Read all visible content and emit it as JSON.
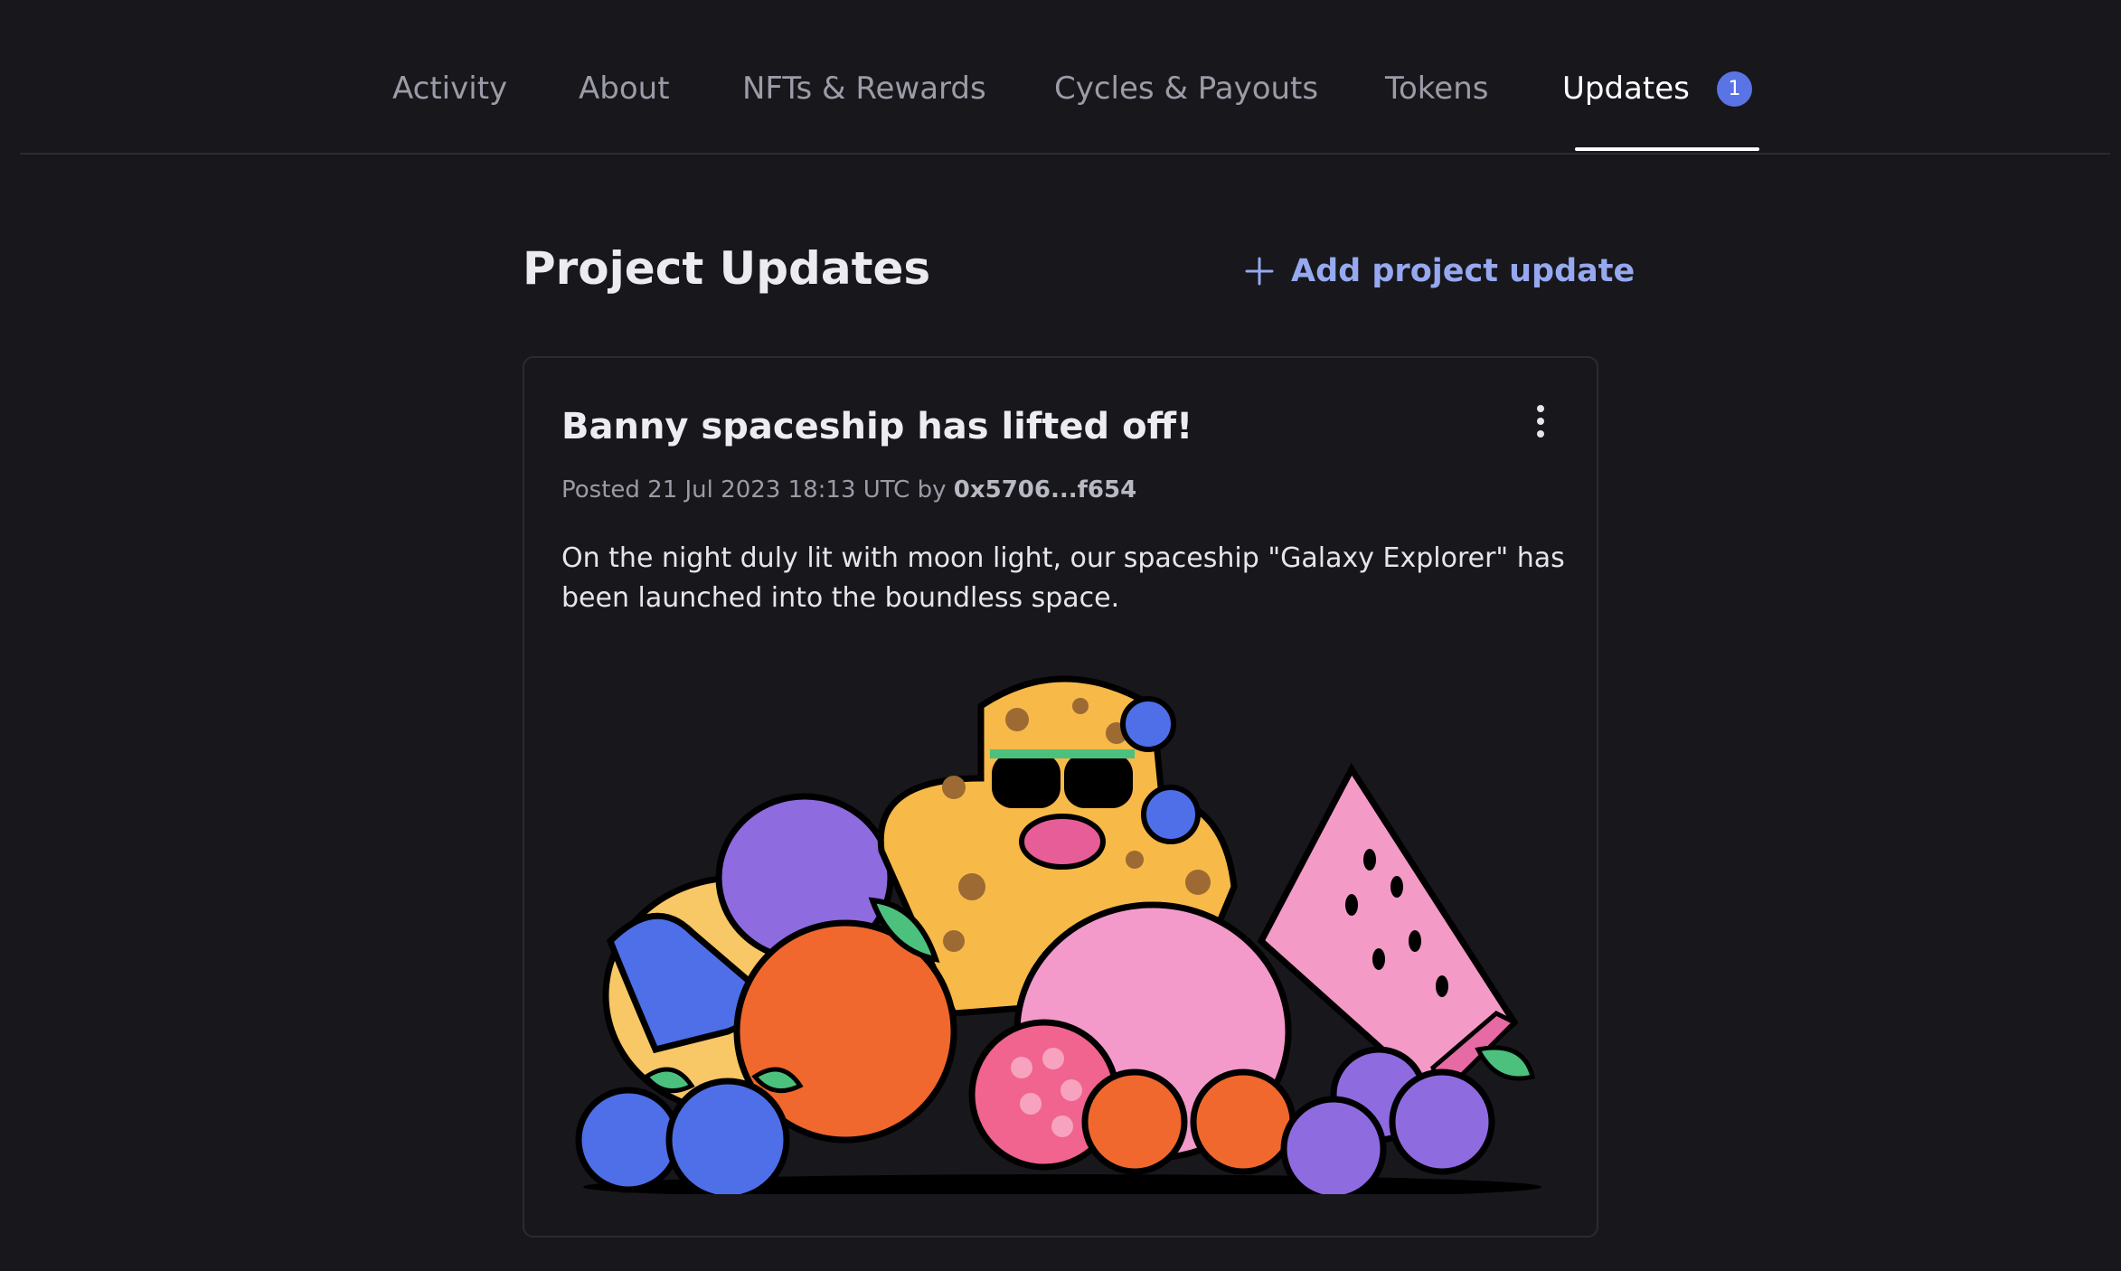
{
  "tabs": [
    {
      "label": "Activity"
    },
    {
      "label": "About"
    },
    {
      "label": "NFTs & Rewards"
    },
    {
      "label": "Cycles & Payouts"
    },
    {
      "label": "Tokens"
    },
    {
      "label": "Updates",
      "badge": "1",
      "active": true
    }
  ],
  "main": {
    "title": "Project Updates",
    "add_button_label": "Add project update"
  },
  "post": {
    "title": "Banny spaceship has lifted off!",
    "posted_prefix": "Posted 21 Jul 2023 18:13 UTC by",
    "author": "0x5706...f654",
    "body": "On the night duly lit with moon light, our spaceship \"Galaxy Explorer\" has been launched into the boundless space."
  },
  "colors": {
    "background": "#17171c",
    "accent": "#96a8f0",
    "badge": "#5a74e6"
  },
  "icons": {
    "add": "plus-icon",
    "menu": "more-vertical-icon"
  }
}
